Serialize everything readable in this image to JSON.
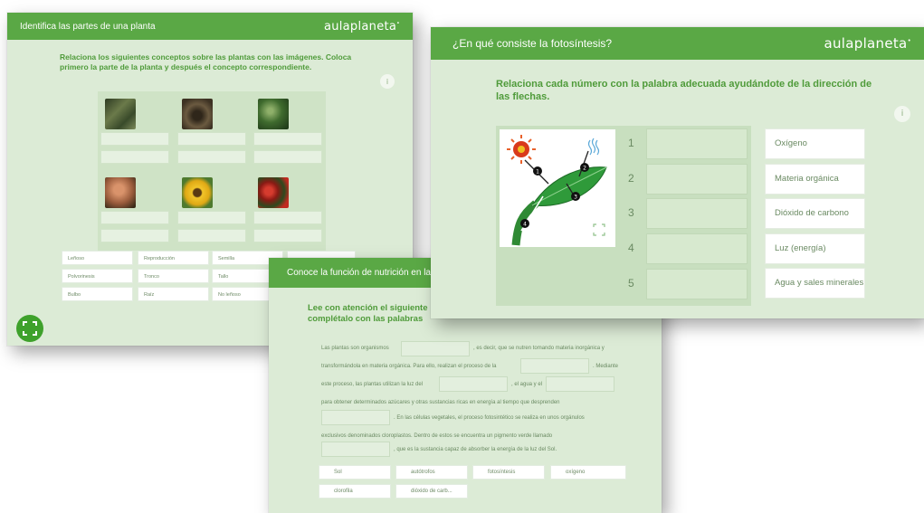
{
  "card1": {
    "title": "Identifica las partes de una planta",
    "logo": "aulaplaneta",
    "instruction": "Relaciona los siguientes conceptos sobre las plantas con las imágenes. Coloca primero la parte de la planta y después el concepto correspondiente.",
    "info": "i",
    "photos": [
      {
        "name": "roots-photo",
        "color": "#4a5a36"
      },
      {
        "name": "trunk-photo",
        "color": "#5b4a35"
      },
      {
        "name": "leaves-photo",
        "color": "#3f6b2e"
      },
      {
        "name": "bulb-photo",
        "color": "#a26a4b"
      },
      {
        "name": "sunflower-photo",
        "color": "#e0b11c"
      },
      {
        "name": "seeds-photo",
        "color": "#a8261f"
      }
    ],
    "words": [
      "Leñoso",
      "Reproducción",
      "Semilla",
      "",
      "Polvorinesis",
      "Tronco",
      "Tallo",
      "",
      "Bulbo",
      "Raíz",
      "No leñoso"
    ]
  },
  "card2": {
    "title": "¿En qué consiste la fotosíntesis?",
    "logo": "aulaplaneta",
    "instruction": "Relaciona cada número con la palabra adecuada ayudándote de la dirección de las flechas.",
    "info": "i",
    "numbers": [
      "1",
      "2",
      "3",
      "4",
      "5"
    ],
    "options": [
      "Oxígeno",
      "Materia orgánica",
      "Dióxido de carbono",
      "Luz (energía)",
      "Agua y sales minerales"
    ],
    "diagram_labels": [
      "1",
      "2",
      "3",
      "4"
    ],
    "colors": {
      "sun": "#d93a1a",
      "leaf": "#2f9a3a",
      "arrow": "#222222"
    }
  },
  "card3": {
    "title": "Conoce la función de nutrición en las p",
    "instruction_lines": [
      "Lee con atención el siguiente",
      "complétalo con las palabras"
    ],
    "paragraph": [
      {
        "pre": "Las plantas son organismos",
        "post": ", es decir, que se nutren tomando materia inorgánica y"
      },
      {
        "pre": "transformándola en materia orgánica. Para ello, realizan el proceso de la",
        "post": ". Mediante"
      },
      {
        "pre": "este proceso, las plantas utilizan la luz del",
        "mid": ", el agua y el",
        "post": ""
      },
      {
        "pre": "para obtener determinados azúcares y otras sustancias ricas en energía al tiempo que desprenden",
        "post": ""
      },
      {
        "pre": "",
        "post": ". En las células vegetales, el proceso fotosintético se realiza en unos orgánulos"
      },
      {
        "pre": "exclusivos denominados cloroplastos. Dentro de estos se encuentra un pigmento verde llamado",
        "post": ""
      },
      {
        "pre": "",
        "post": ", que es la sustancia capaz de absorber la energía de la luz del Sol."
      }
    ],
    "chips": [
      "Sol",
      "autótrofos",
      "fotosíntesis",
      "oxígeno",
      "clorofila",
      "dióxido de carb..."
    ]
  }
}
